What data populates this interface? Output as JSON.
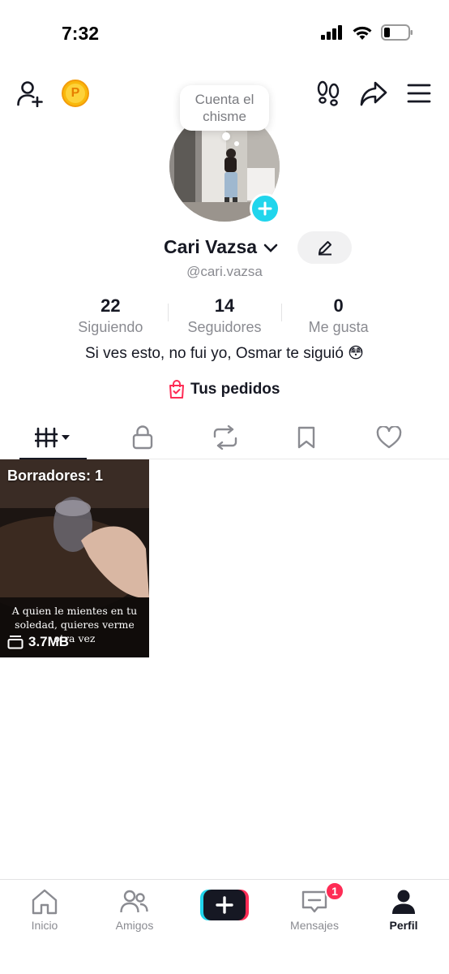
{
  "status_bar": {
    "time": "7:32"
  },
  "top_bar": {
    "coin_letter": "P"
  },
  "note_bubble": {
    "text": "Cuenta el chisme"
  },
  "profile": {
    "display_name": "Cari Vazsa",
    "handle": "@cari.vazsa",
    "stats": [
      {
        "value": "22",
        "label": "Siguiendo"
      },
      {
        "value": "14",
        "label": "Seguidores"
      },
      {
        "value": "0",
        "label": "Me gusta"
      }
    ],
    "bio": "Si ves esto, no fui yo, Osmar te siguió 😳",
    "orders_label": "Tus pedidos"
  },
  "tabs": [
    {
      "icon": "videos-grid-icon",
      "active": true
    },
    {
      "icon": "lock-icon",
      "active": false
    },
    {
      "icon": "repost-icon",
      "active": false
    },
    {
      "icon": "bookmark-icon",
      "active": false
    },
    {
      "icon": "heart-icon",
      "active": false
    }
  ],
  "drafts": {
    "title": "Borradores: 1",
    "caption": "A quien le mientes en tu soledad, quieres verme otra vez",
    "size": "3.7MB"
  },
  "bottom_nav": {
    "items": [
      {
        "label": "Inicio",
        "icon": "home-icon"
      },
      {
        "label": "Amigos",
        "icon": "friends-icon"
      },
      {
        "label": "Mensajes",
        "icon": "inbox-icon",
        "badge": "1"
      },
      {
        "label": "Perfil",
        "icon": "profile-icon",
        "active": true
      }
    ]
  },
  "colors": {
    "accent_cyan": "#20d5ec",
    "accent_red": "#fe2c55",
    "text_primary": "#161823",
    "text_secondary": "#8a8b91",
    "coin": "#f9b80c"
  }
}
